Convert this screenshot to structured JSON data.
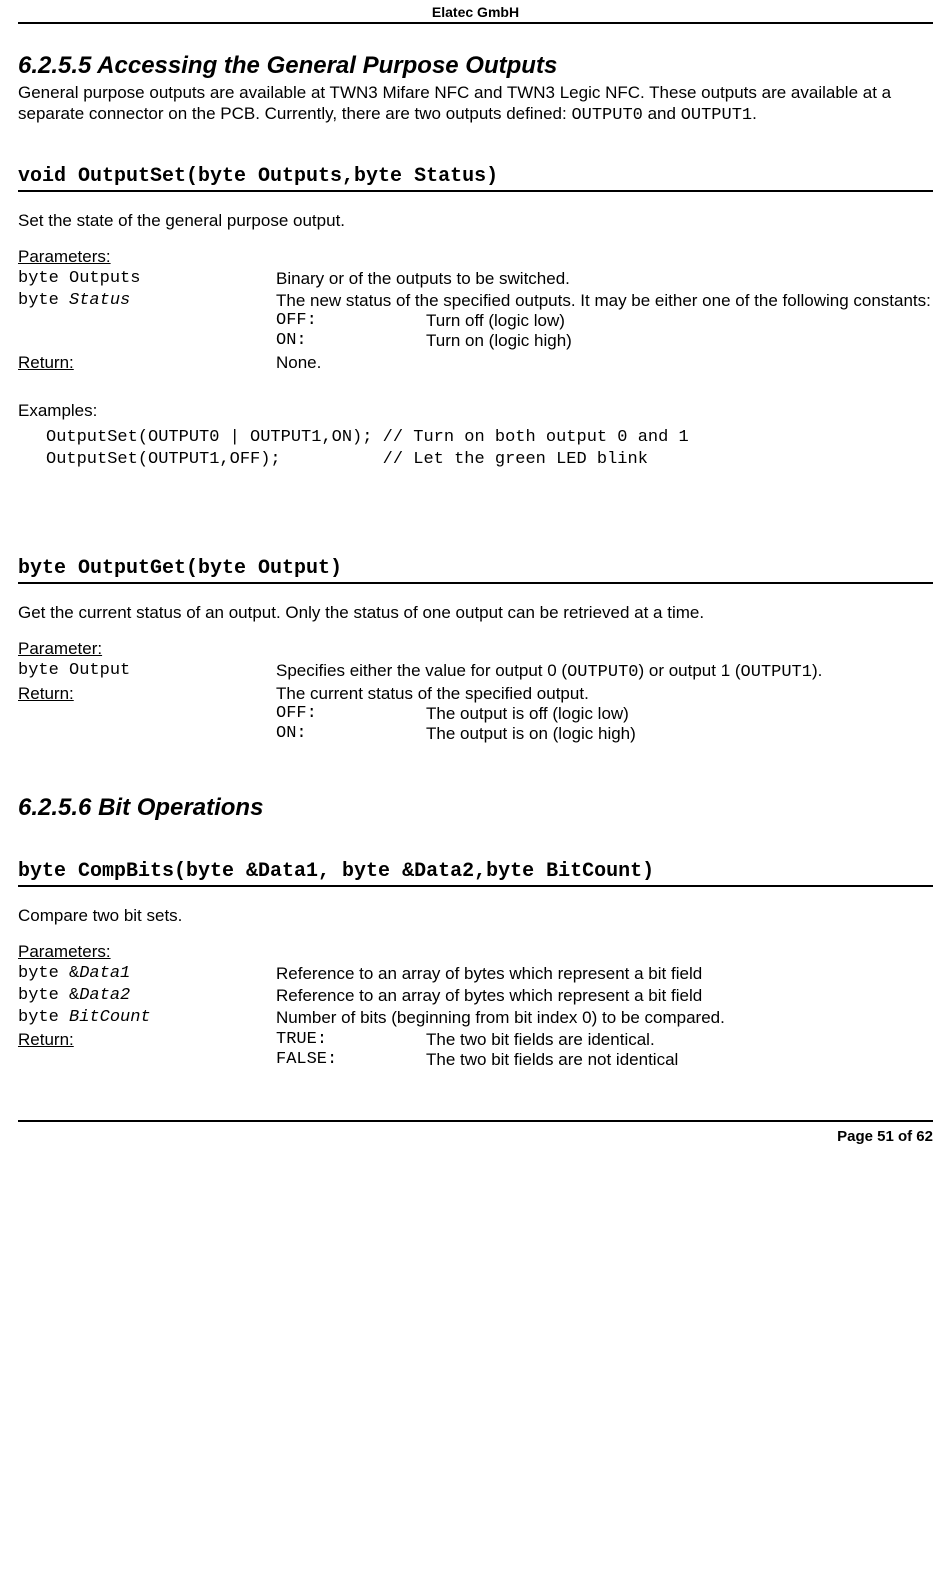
{
  "header": {
    "company": "Elatec GmbH"
  },
  "footer": {
    "page": "Page 51 of 62"
  },
  "sec1": {
    "heading": "6.2.5.5  Accessing the General Purpose Outputs",
    "intro_pre": "General purpose outputs are available at TWN3 Mifare NFC and TWN3 Legic NFC. These outputs are available at a separate connector on the PCB. Currently, there are two outputs defined: ",
    "code_out0": "OUTPUT0",
    "intro_and": " and ",
    "code_out1": "OUTPUT1",
    "intro_end": "."
  },
  "func1": {
    "sig": "void OutputSet(byte Outputs,byte Status)",
    "desc": "Set the state of the general purpose output.",
    "params_label": "Parameters:",
    "p1_name": "byte Outputs",
    "p1_desc": "Binary or of the outputs to be switched.",
    "p2_name_type": "byte ",
    "p2_name_var": "Status",
    "p2_desc": "The new status of the specified outputs. It may be either one of the following constants:",
    "p2_off_key": "OFF",
    "p2_off_colon": ":",
    "p2_off_val": "Turn off (logic low)",
    "p2_on_key": "ON",
    "p2_on_colon": ":",
    "p2_on_val": "Turn on (logic high)",
    "return_label": "Return:",
    "return_val": "None.",
    "examples_label": "Examples:",
    "code": "OutputSet(OUTPUT0 | OUTPUT1,ON); // Turn on both output 0 and 1\nOutputSet(OUTPUT1,OFF);          // Let the green LED blink"
  },
  "func2": {
    "sig": "byte OutputGet(byte Output)",
    "desc": "Get the current status of an output. Only the status of one output can be retrieved at a time.",
    "param_label": "Parameter:",
    "p1_name": "byte Output",
    "p1_desc_pre": "Specifies either the value for output 0 (",
    "p1_code0": "OUTPUT0",
    "p1_desc_mid": ") or output 1 (",
    "p1_code1": "OUTPUT1",
    "p1_desc_end": ").",
    "return_label": "Return:",
    "return_desc": "The current status of the specified output.",
    "off_key": "OFF",
    "off_colon": ":",
    "off_val": "The output is off (logic low)",
    "on_key": "ON",
    "on_colon": ":",
    "on_val": "The output is on (logic high)"
  },
  "sec2": {
    "heading": "6.2.5.6  Bit Operations"
  },
  "func3": {
    "sig": "byte CompBits(byte &Data1, byte &Data2,byte BitCount)",
    "desc": "Compare two bit sets.",
    "params_label": "Parameters:",
    "p1_name_type": "byte &",
    "p1_name_var": "Data1",
    "p1_desc": "Reference to an array of bytes which represent a bit field",
    "p2_name_type": "byte &",
    "p2_name_var": "Data2",
    "p2_desc": "Reference to an array of bytes which represent a bit field",
    "p3_name_type": "byte ",
    "p3_name_var": "BitCount",
    "p3_desc": "Number of bits (beginning from bit index 0) to be compared.",
    "return_label": "Return:",
    "true_key": "TRUE",
    "true_colon": ":",
    "true_val": "The two bit fields are identical.",
    "false_key": "FALSE",
    "false_colon": ":",
    "false_val": "The two bit fields are not identical"
  }
}
